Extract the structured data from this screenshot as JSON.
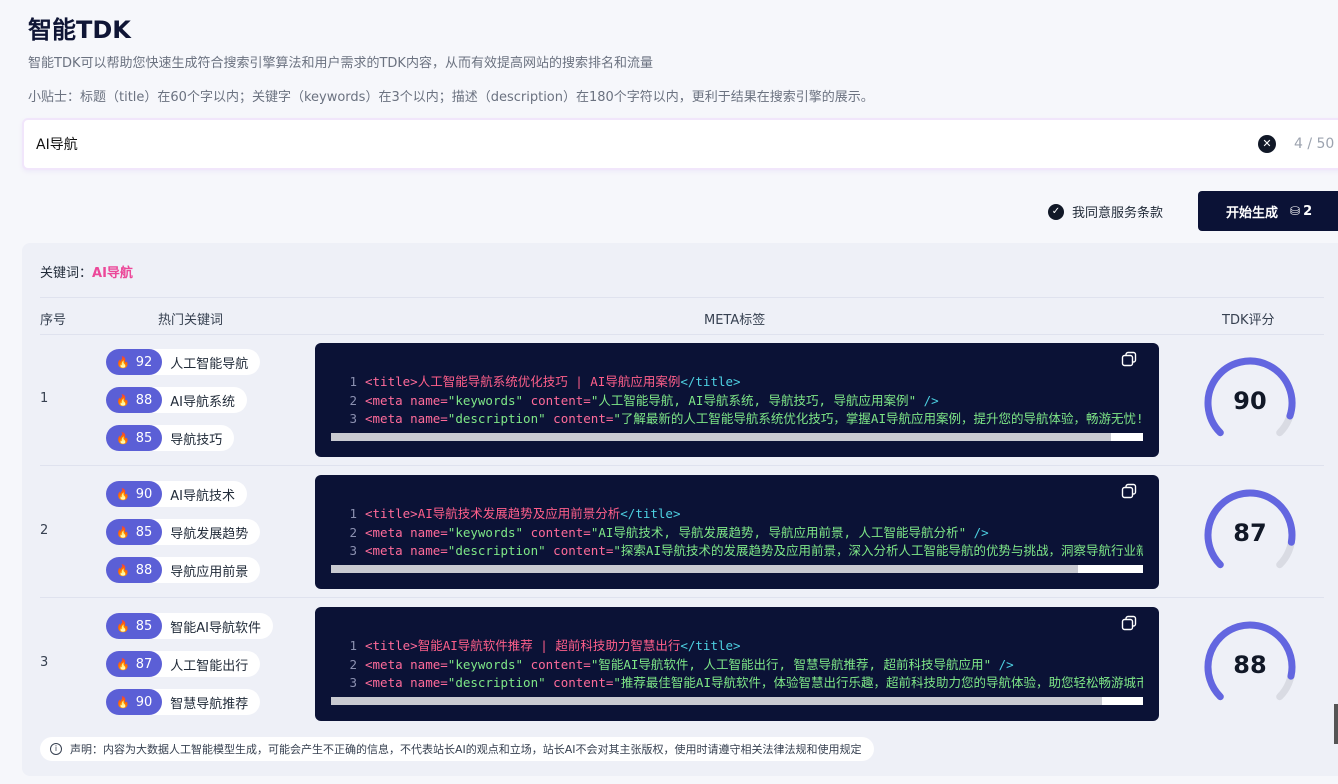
{
  "header": {
    "title": "智能TDK",
    "subtitle": "智能TDK可以帮助您快速生成符合搜索引擎算法和用户需求的TDK内容，从而有效提高网站的搜索排名和流量",
    "tip": "小贴士：标题（title）在60个字以内；关键字（keywords）在3个以内；描述（description）在180个字符以内，更利于结果在搜索引擎的展示。"
  },
  "search": {
    "value": "AI导航",
    "counter": "4 / 50"
  },
  "actions": {
    "agree_label": "我同意服务条款",
    "generate_label": "开始生成",
    "credits": "2"
  },
  "results": {
    "keyword_label": "关键词：",
    "keyword_value": "AI导航",
    "columns": {
      "index": "序号",
      "hot_keywords": "热门关键词",
      "meta": "META标签",
      "score": "TDK评分"
    },
    "rows": [
      {
        "index": "1",
        "tags": [
          {
            "score": "92",
            "word": "人工智能导航"
          },
          {
            "score": "88",
            "word": "AI导航系统"
          },
          {
            "score": "85",
            "word": "导航技巧"
          }
        ],
        "title": "人工智能导航系统优化技巧 | AI导航应用案例",
        "keywords": "人工智能导航, AI导航系统, 导航技巧, 导航应用案例",
        "description": "了解最新的人工智能导航系统优化技巧，掌握AI导航应用案例，提升您的导航体验，畅游无忧!",
        "score": 90,
        "scroll_fraction": 0.96
      },
      {
        "index": "2",
        "tags": [
          {
            "score": "90",
            "word": "AI导航技术"
          },
          {
            "score": "85",
            "word": "导航发展趋势"
          },
          {
            "score": "88",
            "word": "导航应用前景"
          }
        ],
        "title": "AI导航技术发展趋势及应用前景分析",
        "keywords": "AI导航技术, 导航发展趋势, 导航应用前景, 人工智能导航分析",
        "description": "探索AI导航技术的发展趋势及应用前景，深入分析人工智能导航的优势与挑战，洞察导航行业新",
        "score": 87,
        "scroll_fraction": 0.92
      },
      {
        "index": "3",
        "tags": [
          {
            "score": "85",
            "word": "智能AI导航软件"
          },
          {
            "score": "87",
            "word": "人工智能出行"
          },
          {
            "score": "90",
            "word": "智慧导航推荐"
          }
        ],
        "title": "智能AI导航软件推荐 | 超前科技助力智慧出行",
        "keywords": "智能AI导航软件, 人工智能出行, 智慧导航推荐, 超前科技导航应用",
        "description": "推荐最佳智能AI导航软件，体验智慧出行乐趣，超前科技助力您的导航体验，助您轻松畅游城市",
        "score": 88,
        "scroll_fraction": 0.95
      }
    ]
  },
  "notice": "声明：内容为大数据人工智能模型生成，可能会产生不正确的信息，不代表站长AI的观点和立场，站长AI不会对其主张版权，使用时请遵守相关法律法规和使用规定",
  "colors": {
    "accent": "#5b5fd6",
    "dark": "#0b1236",
    "pink": "#ec4899"
  }
}
